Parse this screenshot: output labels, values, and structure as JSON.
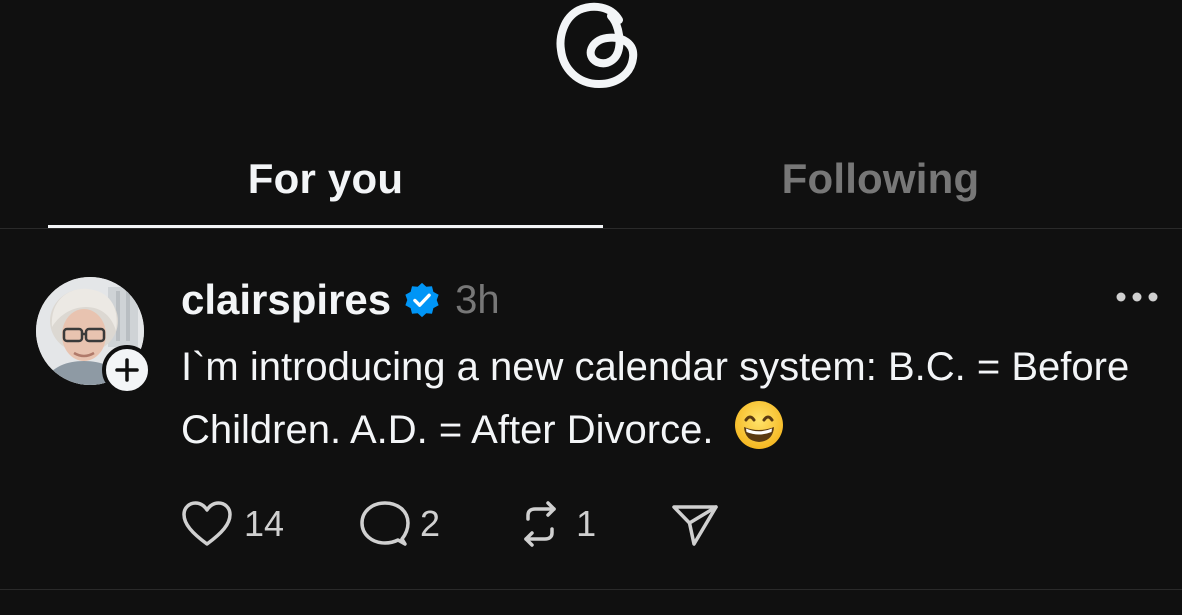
{
  "tabs": [
    {
      "label": "For you",
      "active": true
    },
    {
      "label": "Following",
      "active": false
    }
  ],
  "post": {
    "username": "clairspires",
    "verified": true,
    "timestamp": "3h",
    "text": "I`m introducing a new calendar system: B.C. = Before Children. A.D. = After Divorce.",
    "emoji": "grinning-face-with-smiling-eyes",
    "likes": "14",
    "replies": "2",
    "reposts": "1"
  },
  "icons": {
    "logo": "threads-logo-icon",
    "verified": "verified-badge-icon",
    "more": "more-dots-icon",
    "like": "heart-icon",
    "reply": "comment-bubble-icon",
    "repost": "repost-icon",
    "share": "send-icon",
    "follow": "plus-icon"
  },
  "colors": {
    "background": "#101010",
    "text": "#f3f5f7",
    "muted": "#777777",
    "verified": "#0095f6"
  }
}
